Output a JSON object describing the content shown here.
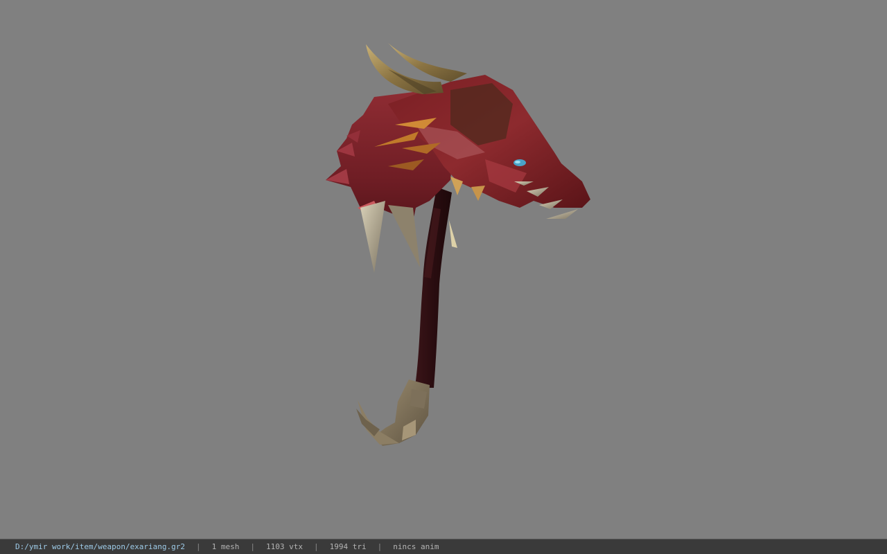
{
  "viewer": {
    "model_name": "exariang",
    "icon": "dragon-head-scythe-model",
    "background_color": "#808080"
  },
  "status_bar": {
    "file_path": "D:/ymir work/item/weapon/exariang.gr2",
    "separator": "|",
    "mesh_count": "1 mesh",
    "vertex_count": "1103 vtx",
    "triangle_count": "1994 tri",
    "animation": "nincs anim",
    "path_color": "#9ecbe8",
    "text_color": "#b4b4b4"
  }
}
